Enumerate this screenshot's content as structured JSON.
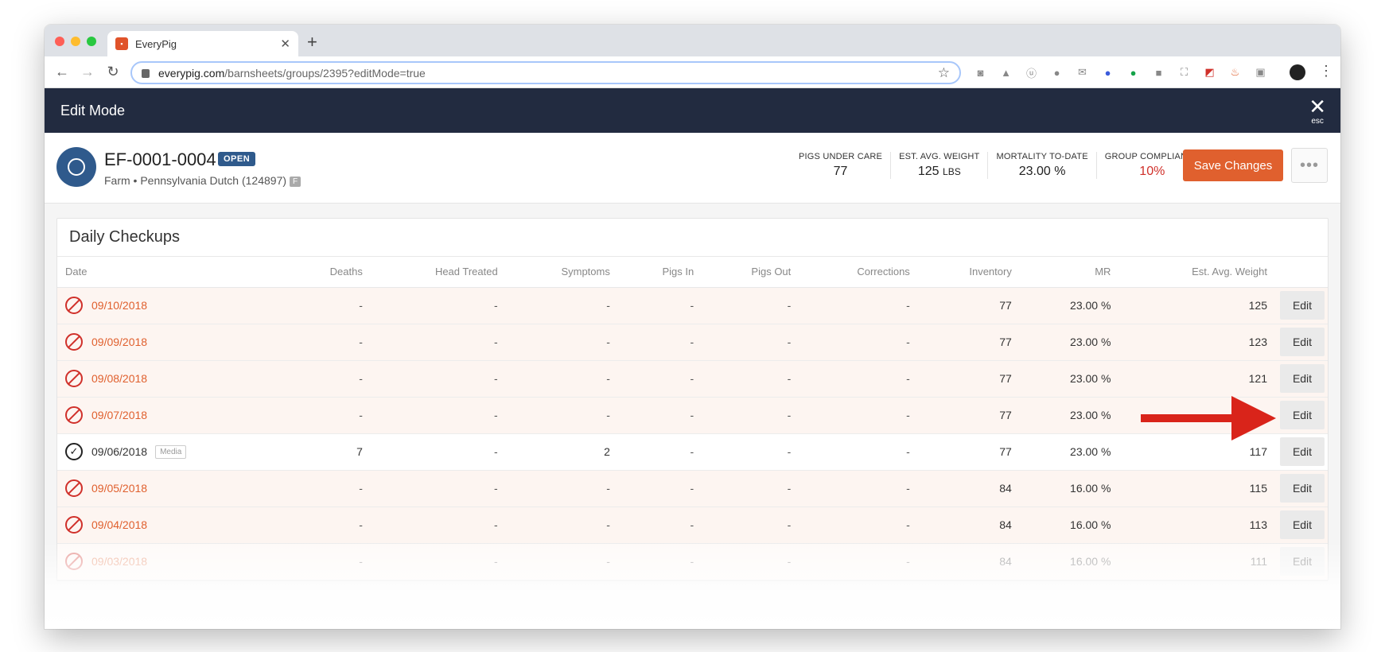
{
  "browser": {
    "tab_title": "EveryPig",
    "url_domain": "everypig.com",
    "url_path": "/barnsheets/groups/2395?editMode=true"
  },
  "app": {
    "mode_title": "Edit Mode",
    "esc_label": "esc",
    "group_name": "EF-0001-0004",
    "status_badge": "OPEN",
    "group_sub": "Farm • Pennsylvania Dutch (124897)",
    "farm_badge": "F",
    "stats": [
      {
        "label": "PIGS UNDER CARE",
        "value": "77",
        "unit": ""
      },
      {
        "label": "EST. AVG. WEIGHT",
        "value": "125",
        "unit": "LBS"
      },
      {
        "label": "MORTALITY TO-DATE",
        "value": "23.00 %",
        "unit": ""
      },
      {
        "label": "GROUP COMPLIANCE",
        "value": "10%",
        "unit": ""
      }
    ],
    "save_label": "Save Changes"
  },
  "checkups": {
    "title": "Daily Checkups",
    "columns": [
      "Date",
      "Deaths",
      "Head Treated",
      "Symptoms",
      "Pigs In",
      "Pigs Out",
      "Corrections",
      "Inventory",
      "MR",
      "Est. Avg. Weight"
    ],
    "edit_label": "Edit",
    "media_label": "Media",
    "rows": [
      {
        "date": "09/10/2018",
        "deaths": "-",
        "head_treated": "-",
        "symptoms": "-",
        "pigs_in": "-",
        "pigs_out": "-",
        "corrections": "-",
        "inventory": "77",
        "mr": "23.00 %",
        "weight": "125",
        "status": "missed"
      },
      {
        "date": "09/09/2018",
        "deaths": "-",
        "head_treated": "-",
        "symptoms": "-",
        "pigs_in": "-",
        "pigs_out": "-",
        "corrections": "-",
        "inventory": "77",
        "mr": "23.00 %",
        "weight": "123",
        "status": "missed"
      },
      {
        "date": "09/08/2018",
        "deaths": "-",
        "head_treated": "-",
        "symptoms": "-",
        "pigs_in": "-",
        "pigs_out": "-",
        "corrections": "-",
        "inventory": "77",
        "mr": "23.00 %",
        "weight": "121",
        "status": "missed"
      },
      {
        "date": "09/07/2018",
        "deaths": "-",
        "head_treated": "-",
        "symptoms": "-",
        "pigs_in": "-",
        "pigs_out": "-",
        "corrections": "-",
        "inventory": "77",
        "mr": "23.00 %",
        "weight": "",
        "status": "missed"
      },
      {
        "date": "09/06/2018",
        "deaths": "7",
        "head_treated": "-",
        "symptoms": "2",
        "pigs_in": "-",
        "pigs_out": "-",
        "corrections": "-",
        "inventory": "77",
        "mr": "23.00 %",
        "weight": "117",
        "status": "done"
      },
      {
        "date": "09/05/2018",
        "deaths": "-",
        "head_treated": "-",
        "symptoms": "-",
        "pigs_in": "-",
        "pigs_out": "-",
        "corrections": "-",
        "inventory": "84",
        "mr": "16.00 %",
        "weight": "115",
        "status": "missed"
      },
      {
        "date": "09/04/2018",
        "deaths": "-",
        "head_treated": "-",
        "symptoms": "-",
        "pigs_in": "-",
        "pigs_out": "-",
        "corrections": "-",
        "inventory": "84",
        "mr": "16.00 %",
        "weight": "113",
        "status": "missed"
      },
      {
        "date": "09/03/2018",
        "deaths": "-",
        "head_treated": "-",
        "symptoms": "-",
        "pigs_in": "-",
        "pigs_out": "-",
        "corrections": "-",
        "inventory": "84",
        "mr": "16.00 %",
        "weight": "111",
        "status": "missed"
      }
    ]
  },
  "colors": {
    "accent": "#e0602e",
    "header_bg": "#222b40",
    "brand_blue": "#2f5a8c",
    "alert_red": "#d0302a",
    "annotation_arrow": "#d9241a"
  }
}
